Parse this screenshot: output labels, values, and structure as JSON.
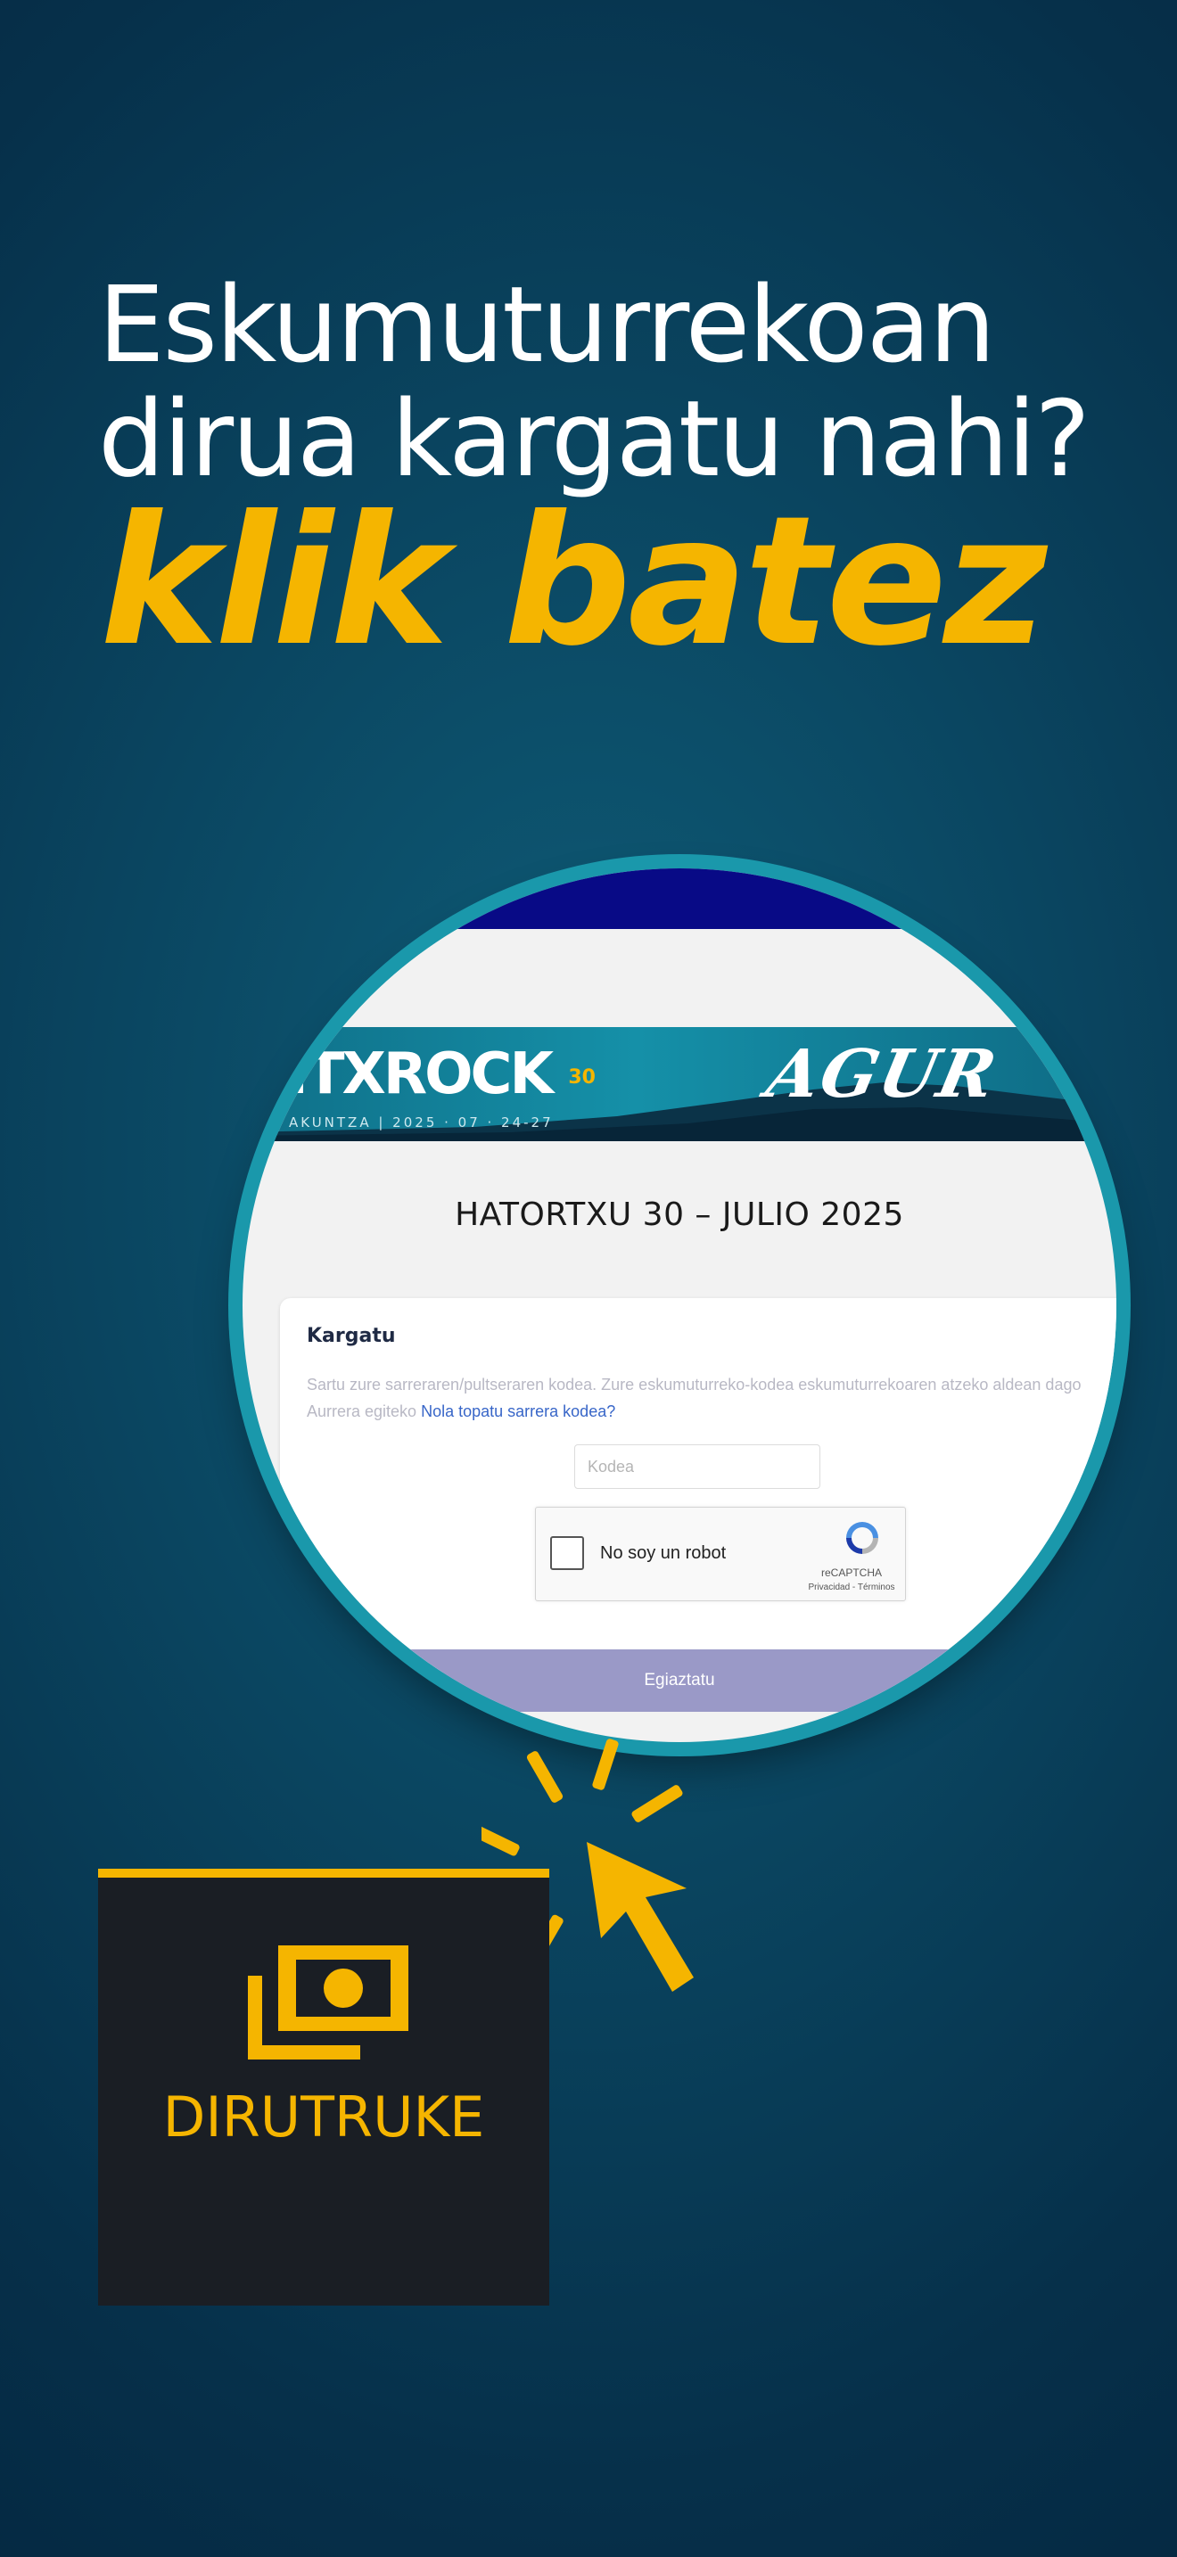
{
  "headline": {
    "line1": "Eskumuturrekoan",
    "line2": "dirua kargatu nahi?",
    "slogan": "klik batez"
  },
  "screenshot": {
    "brand": {
      "logo_text": "ITXROCK",
      "logo_badge": "30",
      "subline": "AKUNTZA | 2025 · 07 · 24-27",
      "agur": "AGUR"
    },
    "event_title": "HATORTXU 30 – JULIO 2025",
    "form": {
      "title": "Kargatu",
      "description": "Sartu zure sarreraren/pultseraren kodea. Zure eskumuturreko-kodea eskumuturrekoaren atzeko aldean dago Aurrera egiteko",
      "help_link": "Nola topatu sarrera kodea?",
      "code_placeholder": "Kodea",
      "captcha_label": "No soy un robot",
      "captcha_brand": "reCAPTCHA",
      "captcha_links": "Privacidad - Términos",
      "submit_label": "Egiaztatu"
    }
  },
  "promo": {
    "brand_name": "DIRUTRUKE",
    "icons": [
      "money-icon",
      "cursor-click-icon"
    ]
  },
  "colors": {
    "accent": "#f5b500",
    "background": "#0a4560",
    "ring": "#1a98ab",
    "navbar": "#080a86",
    "submit": "#9a99c7",
    "brandbox": "#1a1e24"
  }
}
